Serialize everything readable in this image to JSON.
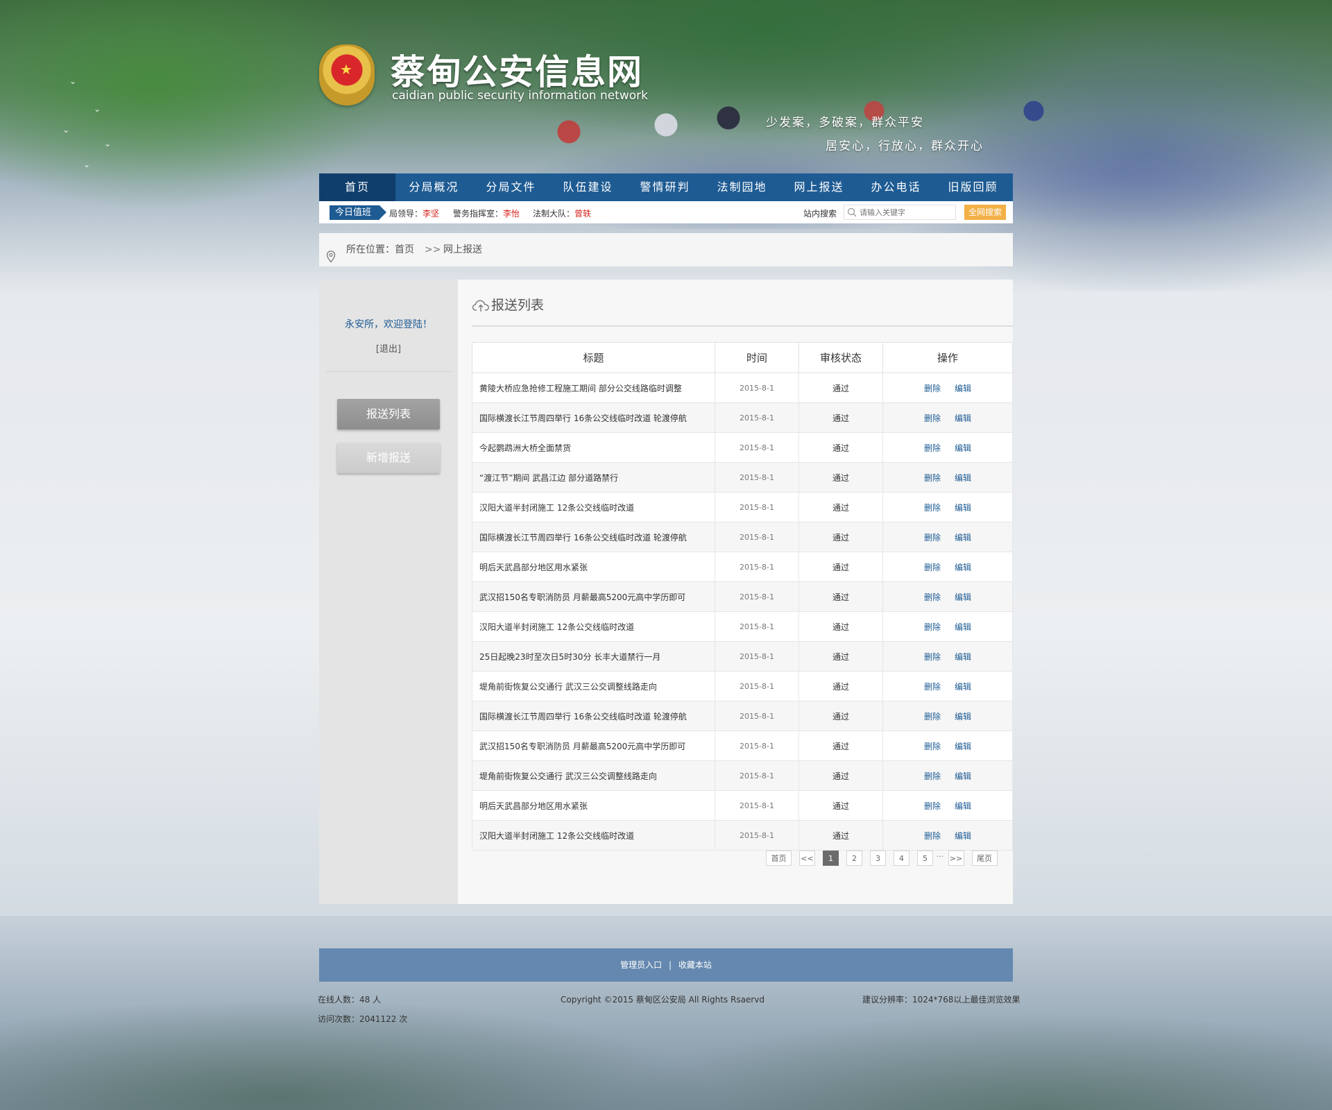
{
  "site": {
    "title": "蔡甸公安信息网",
    "subtitle": "caidian  public security information network",
    "slogan_line1": "少发案，多破案，群众平安",
    "slogan_line2": "居安心，行放心，群众开心"
  },
  "nav": {
    "items": [
      "首页",
      "分局概况",
      "分局文件",
      "队伍建设",
      "警情研判",
      "法制园地",
      "网上报送",
      "办公电话",
      "旧版回顾"
    ],
    "active_index": 0
  },
  "duty": {
    "tag": "今日值班",
    "leader_label": "局领导：",
    "leader_name": "李坚",
    "command_label": "警务指挥室：",
    "command_name": "李怡",
    "legal_label": "法制大队：",
    "legal_name": "曾轶"
  },
  "search": {
    "label": "站内搜索",
    "placeholder": "请输入关键字",
    "button": "全网搜索"
  },
  "breadcrumb": {
    "label": "所在位置：",
    "home": "首页",
    "separator": ">>",
    "current": "网上报送"
  },
  "sidebar": {
    "welcome": "永安所，欢迎登陆！",
    "logout": "[退出]",
    "buttons": [
      "报送列表",
      "新增报送"
    ]
  },
  "content": {
    "title": "报送列表",
    "columns": [
      "标题",
      "时间",
      "审核状态",
      "操作"
    ],
    "op_delete": "删除",
    "op_edit": "编辑",
    "rows": [
      {
        "title": "黄陵大桥应急抢修工程施工期间 部分公交线路临时调整",
        "time": "2015-8-1",
        "status": "通过"
      },
      {
        "title": "国际横渡长江节周四举行 16条公交线临时改道 轮渡停航",
        "time": "2015-8-1",
        "status": "通过"
      },
      {
        "title": "今起鹦鹉洲大桥全面禁货",
        "time": "2015-8-1",
        "status": "通过"
      },
      {
        "title": "“渡江节”期间 武昌江边 部分道路禁行",
        "time": "2015-8-1",
        "status": "通过"
      },
      {
        "title": "汉阳大道半封闭施工 12条公交线临时改道",
        "time": "2015-8-1",
        "status": "通过"
      },
      {
        "title": "国际横渡长江节周四举行 16条公交线临时改道 轮渡停航",
        "time": "2015-8-1",
        "status": "通过"
      },
      {
        "title": "明后天武昌部分地区用水紧张",
        "time": "2015-8-1",
        "status": "通过"
      },
      {
        "title": "武汉招150名专职消防员 月薪最高5200元高中学历即可",
        "time": "2015-8-1",
        "status": "通过"
      },
      {
        "title": "汉阳大道半封闭施工 12条公交线临时改道",
        "time": "2015-8-1",
        "status": "通过"
      },
      {
        "title": "25日起晚23时至次日5时30分 长丰大道禁行一月",
        "time": "2015-8-1",
        "status": "通过"
      },
      {
        "title": "堤角前街恢复公交通行 武汉三公交调整线路走向",
        "time": "2015-8-1",
        "status": "通过"
      },
      {
        "title": "国际横渡长江节周四举行 16条公交线临时改道 轮渡停航",
        "time": "2015-8-1",
        "status": "通过"
      },
      {
        "title": "武汉招150名专职消防员 月薪最高5200元高中学历即可",
        "time": "2015-8-1",
        "status": "通过"
      },
      {
        "title": "堤角前街恢复公交通行 武汉三公交调整线路走向",
        "time": "2015-8-1",
        "status": "通过"
      },
      {
        "title": "明后天武昌部分地区用水紧张",
        "time": "2015-8-1",
        "status": "通过"
      },
      {
        "title": "汉阳大道半封闭施工 12条公交线临时改道",
        "time": "2015-8-1",
        "status": "通过"
      }
    ]
  },
  "pager": {
    "first": "首页",
    "prev": "<<",
    "pages": [
      "1",
      "2",
      "3",
      "4",
      "5"
    ],
    "current": "1",
    "ellipsis": "···",
    "next": ">>",
    "last": "尾页"
  },
  "footer": {
    "admin_link": "管理员入口",
    "divider": "|",
    "bookmark_link": "收藏本站",
    "online": "在线人数：48 人",
    "visits": "访问次数：2041122 次",
    "copyright": "Copyright ©2015  蔡甸区公安局  All Rights Rsaervd",
    "resolution": "建议分辨率：1024*768以上最佳浏览效果"
  },
  "colors": {
    "nav_bg": "#1e5b93",
    "nav_active": "#0f3e6c",
    "duty_name": "#d5231c",
    "search_button": "#f2b047",
    "footer_bar": "#6488af",
    "link": "#1e5b93"
  },
  "icons": [
    "police-emblem-icon",
    "search-icon",
    "location-pin-icon",
    "cloud-upload-icon"
  ]
}
